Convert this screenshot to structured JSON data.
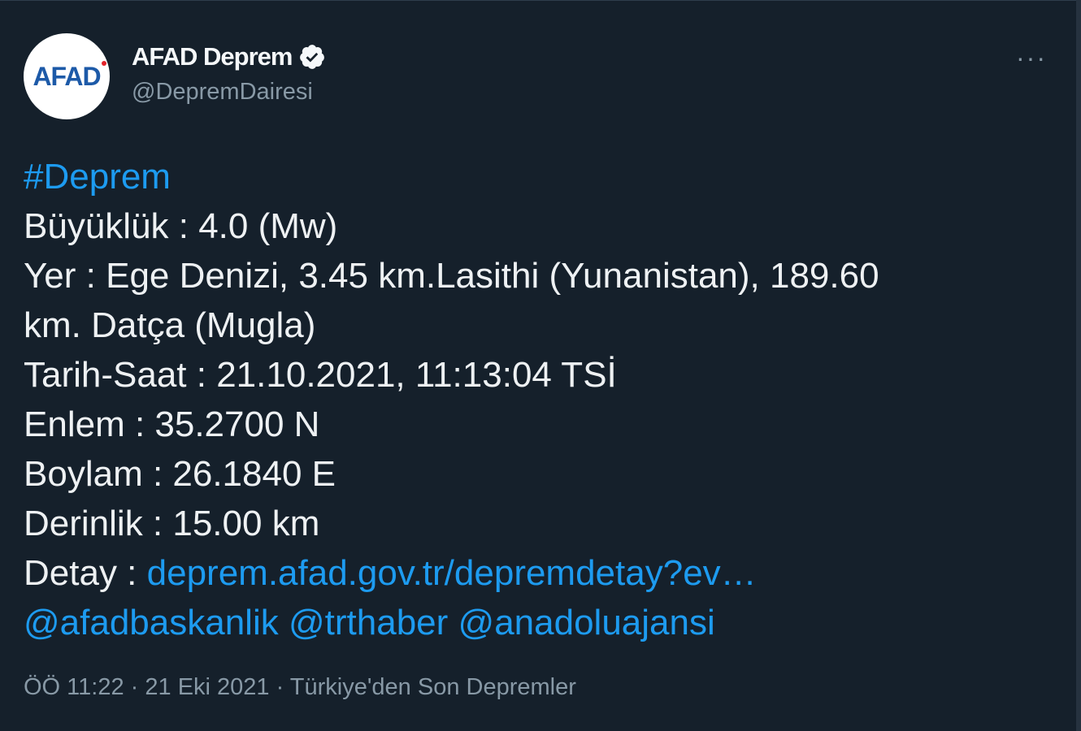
{
  "tweet": {
    "display_name": "AFAD Deprem",
    "handle": "@DepremDairesi",
    "avatar_text": "AFAD",
    "more_label": "···",
    "hashtag": "#Deprem",
    "lines": {
      "buyukluk": "Büyüklük : 4.0 (Mw)",
      "yer_1": "Yer : Ege Denizi, 3.45 km.Lasithi (Yunanistan), 189.60",
      "yer_2": "km. Datça (Mugla)",
      "tarih": "Tarih-Saat : 21.10.2021, 11:13:04 TSİ",
      "enlem": "Enlem : 35.2700 N",
      "boylam": "Boylam : 26.1840 E",
      "derinlik": "Derinlik : 15.00 km",
      "detay_label": "Detay : "
    },
    "detail_link": "deprem.afad.gov.tr/depremdetay?ev…",
    "mentions": [
      "@afadbaskanlik",
      "@trthaber",
      "@anadoluajansi"
    ],
    "meta": {
      "time": "ÖÖ 11:22",
      "date": "21 Eki 2021",
      "source": "Türkiye'den Son Depremler",
      "separator": " · "
    }
  },
  "colors": {
    "background": "#15202b",
    "link": "#1d9bf0",
    "muted": "#8899a6",
    "brand": "#1d5aa8"
  }
}
